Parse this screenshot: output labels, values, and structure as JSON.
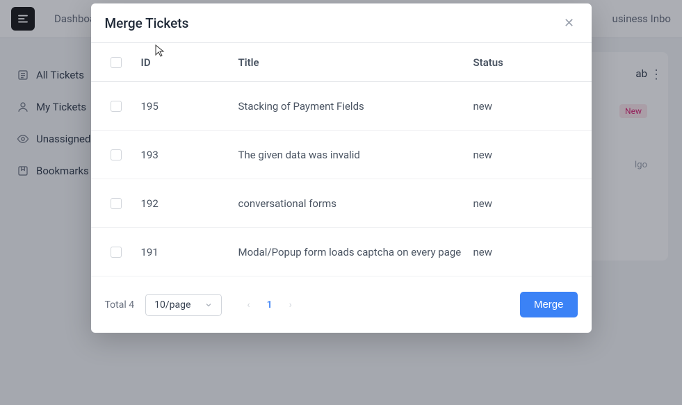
{
  "topnav": {
    "links": [
      "Dashboard"
    ],
    "right": "usiness Inbo"
  },
  "sidebar": {
    "items": [
      {
        "label": "All Tickets"
      },
      {
        "label": "My Tickets"
      },
      {
        "label": "Unassigned"
      },
      {
        "label": "Bookmarks"
      }
    ]
  },
  "bg": {
    "tab": "ab",
    "badge": "New",
    "time": "Igo"
  },
  "modal": {
    "title": "Merge Tickets",
    "columns": {
      "id": "ID",
      "title": "Title",
      "status": "Status"
    },
    "rows": [
      {
        "id": "195",
        "title": "Stacking of Payment Fields",
        "status": "new"
      },
      {
        "id": "193",
        "title": "The given data was invalid",
        "status": "new"
      },
      {
        "id": "192",
        "title": "conversational forms",
        "status": "new"
      },
      {
        "id": "191",
        "title": "Modal/Popup form loads captcha on every page",
        "status": "new"
      }
    ],
    "footer": {
      "total": "Total 4",
      "page_size": "10/page",
      "current_page": "1",
      "merge_label": "Merge"
    }
  }
}
